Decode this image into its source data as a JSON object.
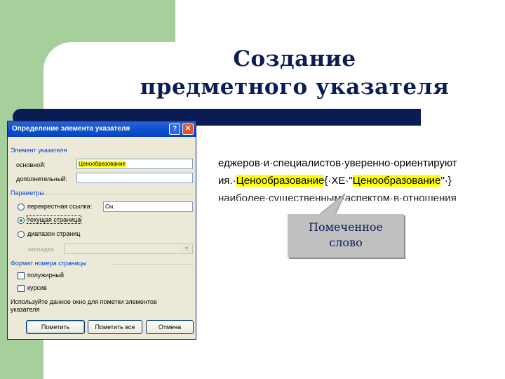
{
  "slide": {
    "title_line1": "Создание",
    "title_line2": "предметного указателя",
    "colors": {
      "green": "#a6cf9c",
      "navy": "#0b1c55",
      "highlight": "#ffff00"
    }
  },
  "dialog": {
    "title": "Определение элемента указателя",
    "help_icon": "question-mark-icon",
    "close_icon": "close-icon",
    "group_element": "Элемент указателя",
    "main_label": "основной:",
    "main_value": "Ценообразование",
    "extra_label": "дополнительный:",
    "extra_value": "",
    "group_params": "Параметры",
    "cross_ref_label": "перекрестная ссылка:",
    "cross_ref_value": "См.",
    "current_page_label": "текущая страница",
    "page_range_label": "диапазон страниц",
    "bookmark_label": "закладка",
    "group_format": "Формат номера страницы",
    "bold_label": "полужирный",
    "italic_label": "курсив",
    "hint": "Используйте данное окно для пометки элементов указателя",
    "btn_mark": "Пометить",
    "btn_mark_all": "Пометить все",
    "btn_cancel": "Отмена"
  },
  "document": {
    "line1": "еджеров·и·специалистов·уверенно·ориентируют",
    "line2_start": "ия.·",
    "line2_word": "Ценообразование",
    "line2_field_open": "{·XE·\"",
    "line2_field_word": "Ценообразование",
    "line2_field_close": "\"·}",
    "line3": "наиболее·существенным·аспектом·в·отношения"
  },
  "callout": {
    "line1": "Помеченное",
    "line2": "слово"
  }
}
